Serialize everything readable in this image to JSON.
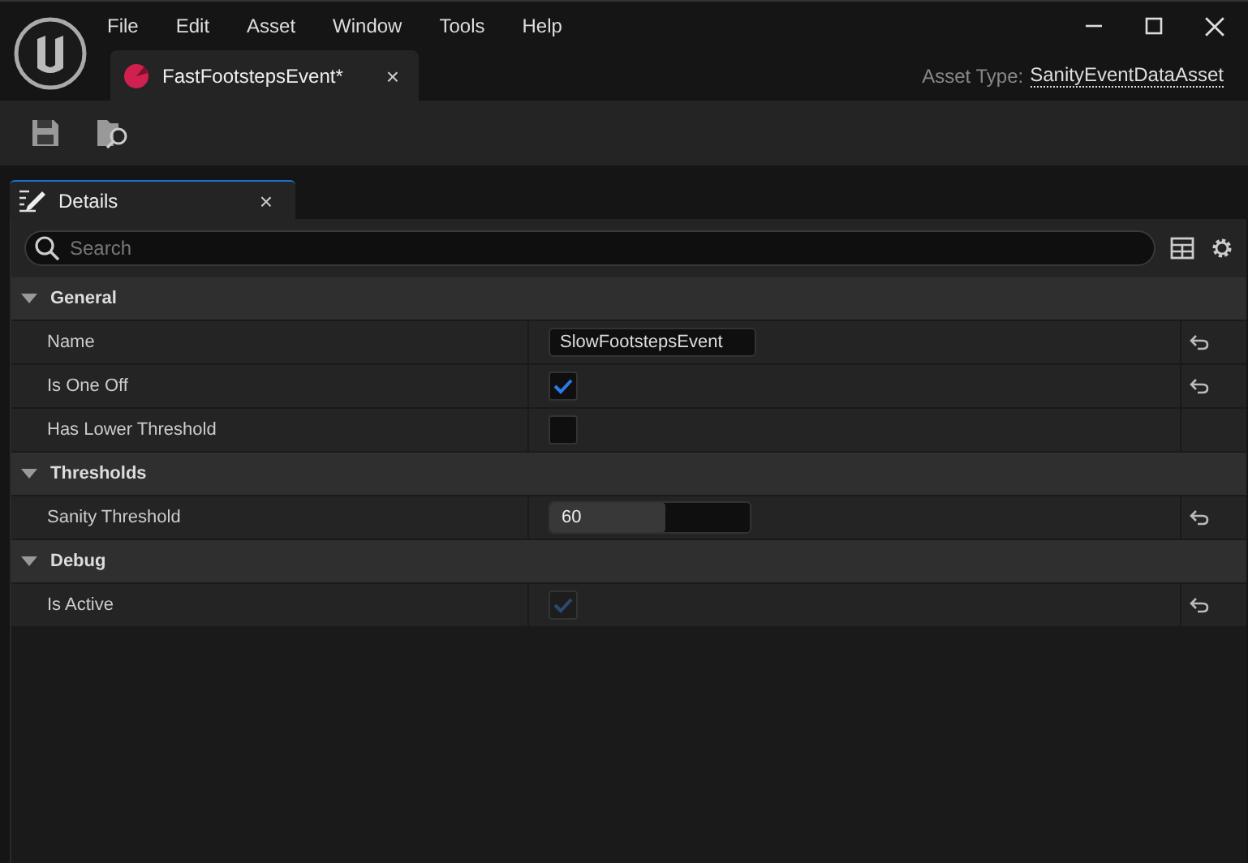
{
  "menu": [
    "File",
    "Edit",
    "Asset",
    "Window",
    "Tools",
    "Help"
  ],
  "document_tab": {
    "title": "FastFootstepsEvent*",
    "close": "×"
  },
  "asset_type": {
    "label": "Asset Type:",
    "value": "SanityEventDataAsset"
  },
  "panel_tab": {
    "title": "Details",
    "close": "×"
  },
  "search": {
    "placeholder": "Search"
  },
  "sections": [
    {
      "title": "General",
      "expanded": true,
      "properties": [
        {
          "label": "Name",
          "kind": "text",
          "value": "SlowFootstepsEvent",
          "resettable": true
        },
        {
          "label": "Is One Off",
          "kind": "checkbox",
          "checked": true,
          "disabled": false,
          "resettable": true
        },
        {
          "label": "Has Lower Threshold",
          "kind": "checkbox",
          "checked": false,
          "disabled": false,
          "resettable": false
        }
      ]
    },
    {
      "title": "Thresholds",
      "expanded": true,
      "properties": [
        {
          "label": "Sanity Threshold",
          "kind": "slider",
          "value": "60",
          "level": 0.58,
          "resettable": true
        }
      ]
    },
    {
      "title": "Debug",
      "expanded": true,
      "properties": [
        {
          "label": "Is Active",
          "kind": "checkbox",
          "checked": true,
          "disabled": true,
          "resettable": true
        }
      ]
    }
  ]
}
